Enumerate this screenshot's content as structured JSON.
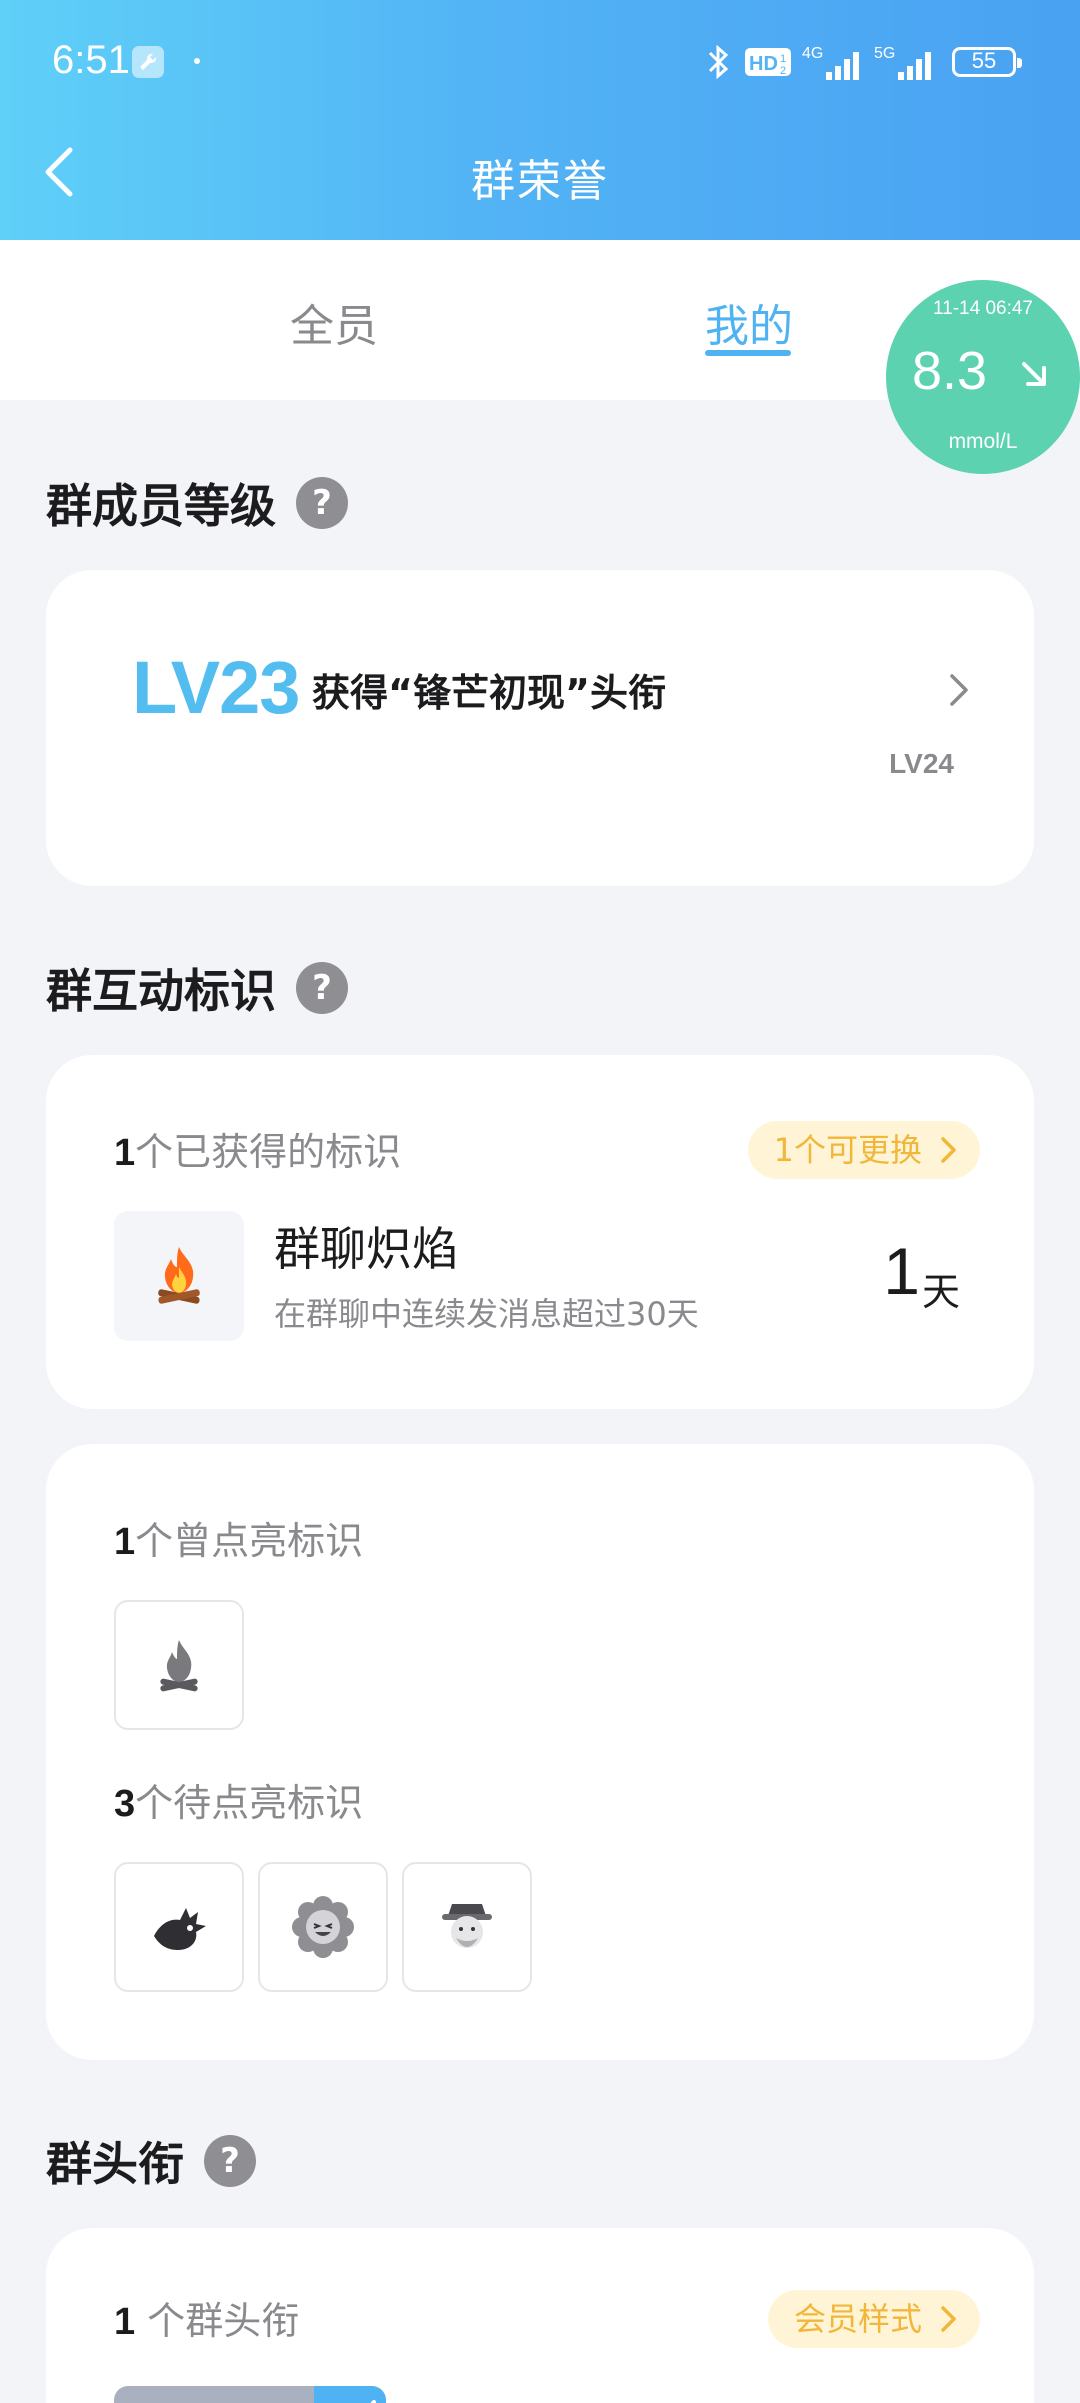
{
  "status_bar": {
    "time": "6:51",
    "battery": "55",
    "icons": [
      "wrench-icon",
      "bluetooth-icon",
      "hd-icon",
      "4g-signal-icon",
      "5g-signal-icon",
      "battery-icon"
    ]
  },
  "header": {
    "title": "群荣誉",
    "back_icon": "chevron-left-icon"
  },
  "tabs": [
    {
      "label": "全员",
      "active": false
    },
    {
      "label": "我的",
      "active": true
    }
  ],
  "glucose": {
    "time": "11-14 06:47",
    "value": "8.3",
    "unit": "mmol/L",
    "trend_icon": "arrow-down-right-icon",
    "color": "#5cd2b0"
  },
  "sections": {
    "level": {
      "title": "群成员等级",
      "current": "LV23",
      "description": "获得“锋芒初现”头衔",
      "next": "LV24"
    },
    "interaction": {
      "title": "群互动标识",
      "earned_count": "1",
      "earned_label": "个已获得的标识",
      "swap_button": "1个可更换",
      "badge_name": "群聊炽焰",
      "badge_desc": "在群聊中连续发消息超过30天",
      "badge_days": "1",
      "badge_days_unit": "天",
      "lit_count": "1",
      "lit_label": "个曾点亮标识",
      "pending_count": "3",
      "pending_label": "个待点亮标识"
    },
    "title_section": {
      "title": "群头衔",
      "count": "1",
      "count_label": " 个群头衔",
      "style_button": "会员样式"
    }
  },
  "colors": {
    "accent": "#4fb3f3",
    "level": "#54bdf0",
    "pill_text": "#f1b63a",
    "pill_bg": "#fff5d6"
  }
}
